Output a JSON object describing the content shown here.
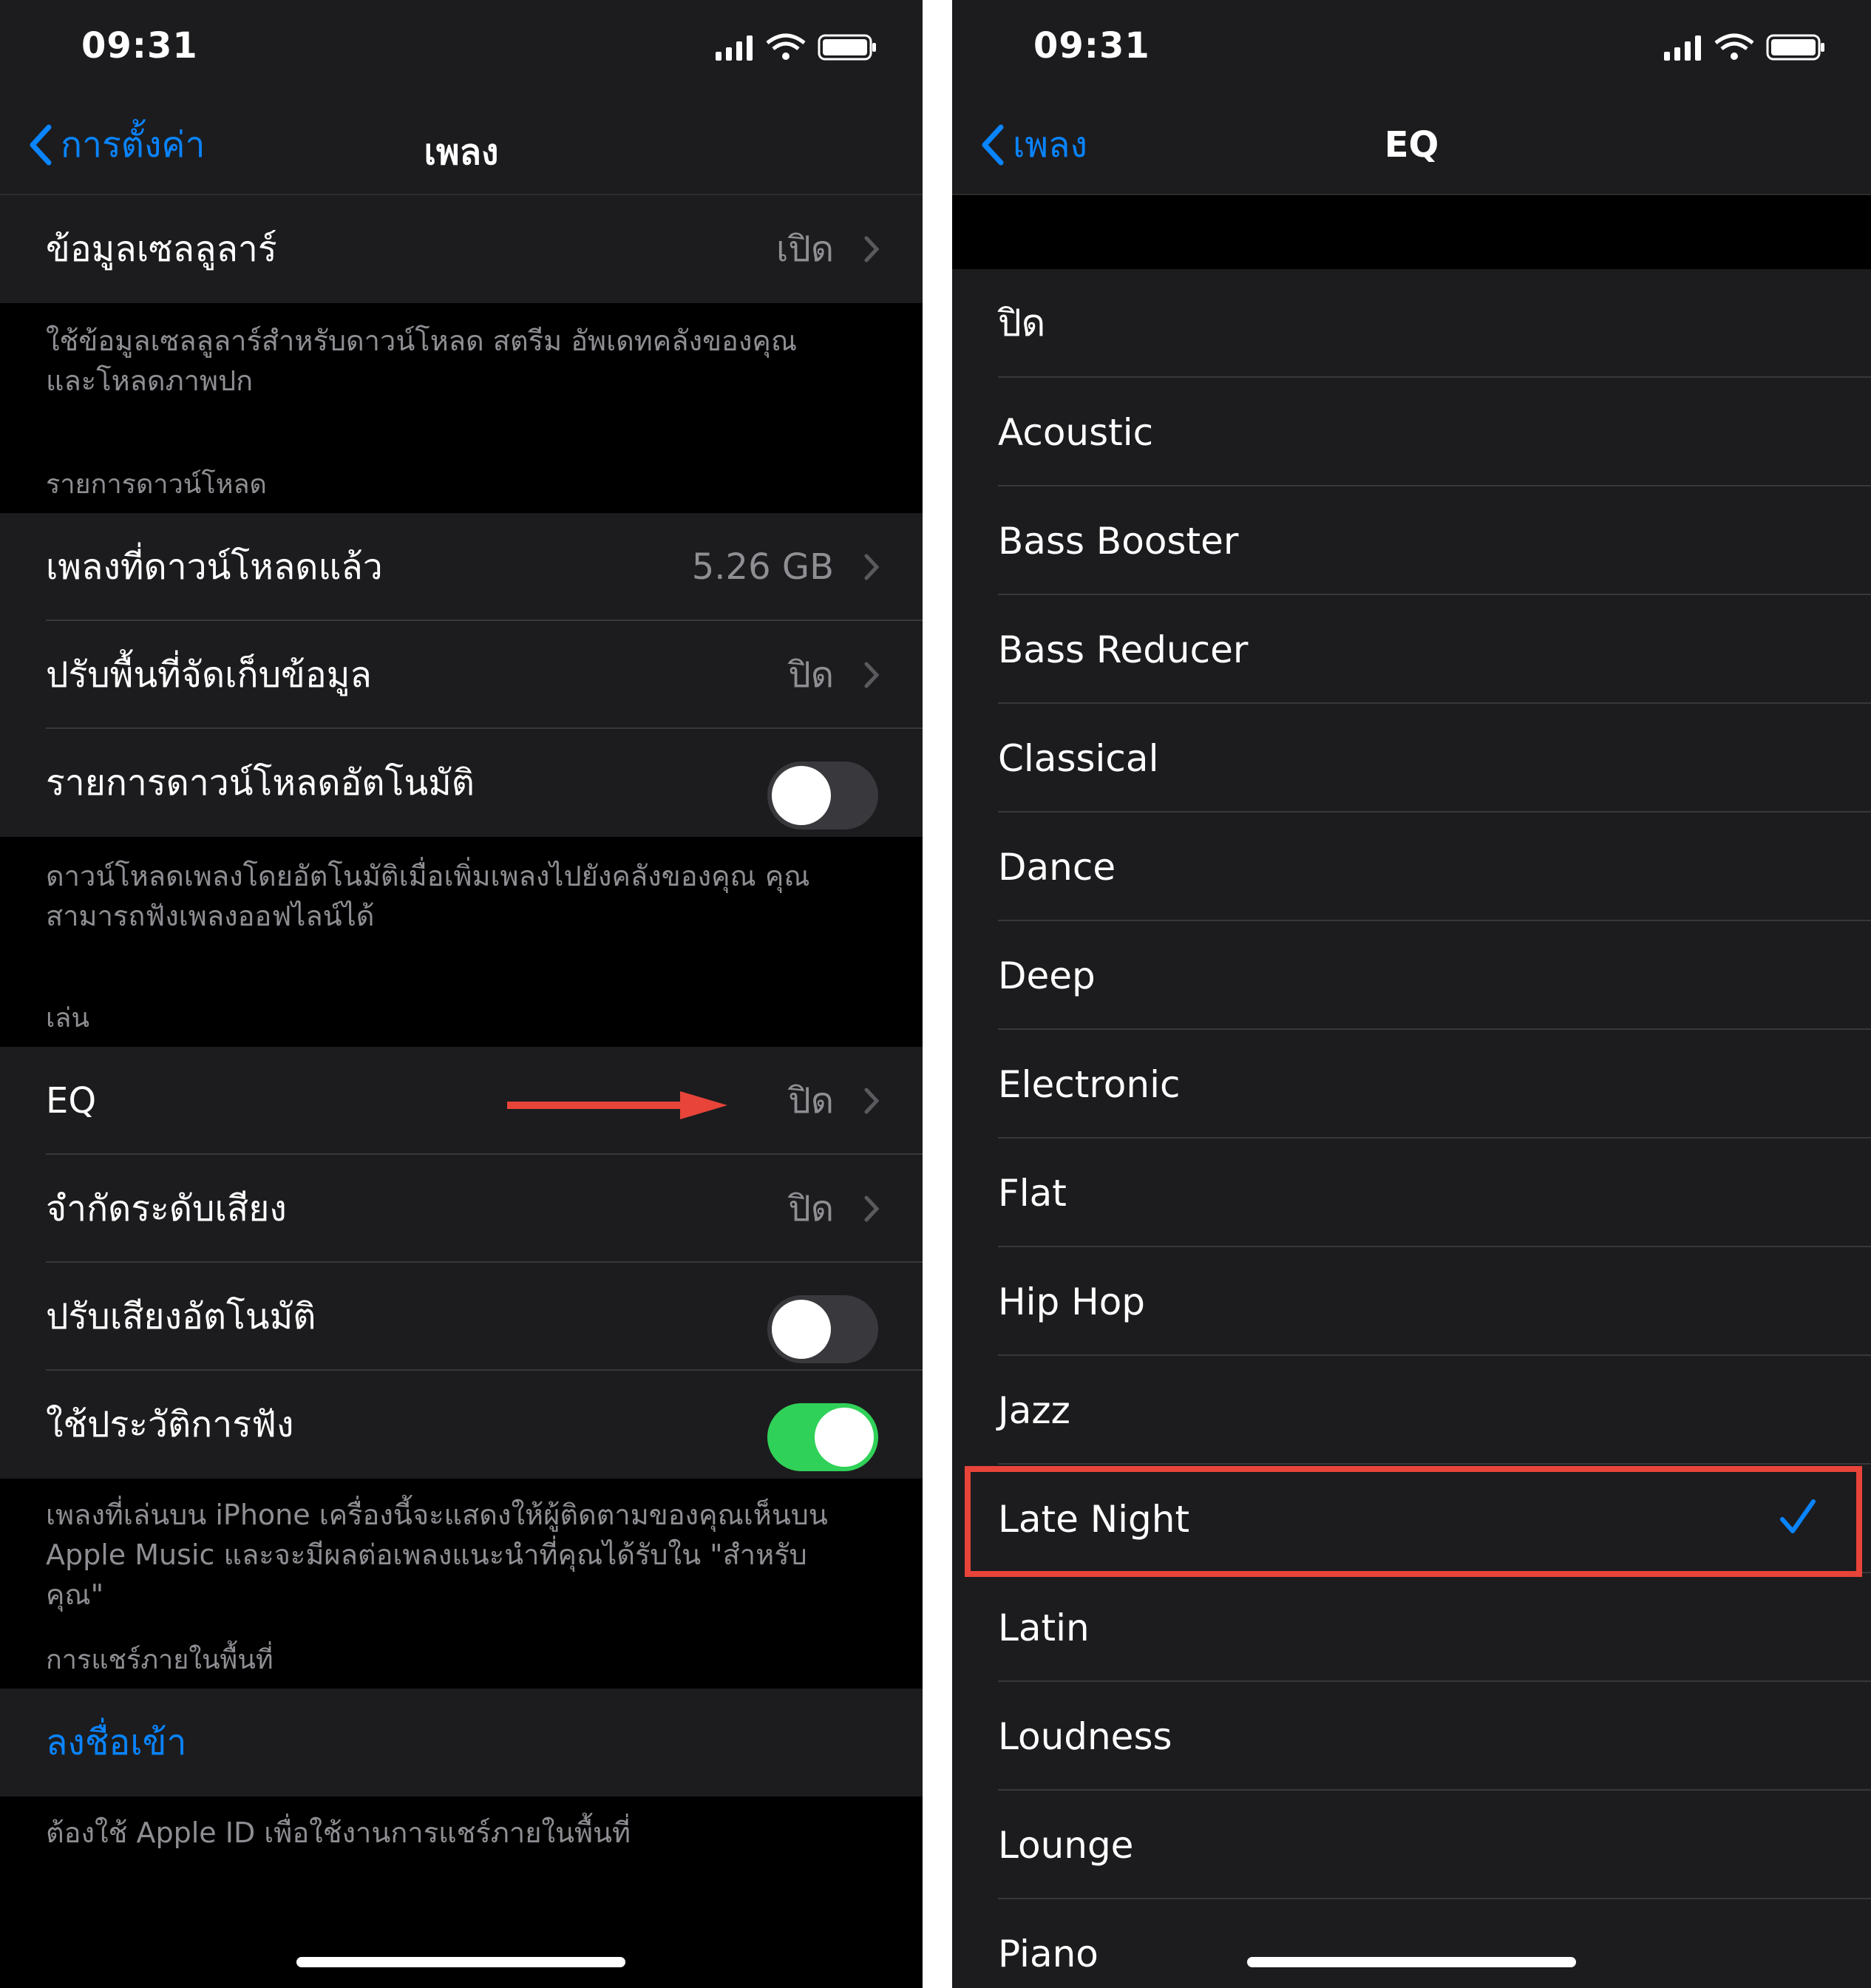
{
  "left": {
    "status": {
      "time": "09:31"
    },
    "nav": {
      "back": "การตั้งค่า",
      "title": "เพลง"
    },
    "cellular": {
      "label": "ข้อมูลเซลลูลาร์",
      "value": "เปิด"
    },
    "cellular_footer": "ใช้ข้อมูลเซลลูลาร์สำหรับดาวน์โหลด สตรีม อัพเดทคลังของคุณ และโหลดภาพปก",
    "downloads_header": "รายการดาวน์โหลด",
    "downloaded": {
      "label": "เพลงที่ดาวน์โหลดแล้ว",
      "value": "5.26 GB"
    },
    "optimize": {
      "label": "ปรับพื้นที่จัดเก็บข้อมูล",
      "value": "ปิด"
    },
    "auto_download": {
      "label": "รายการดาวน์โหลดอัตโนมัติ",
      "on": false
    },
    "auto_footer": "ดาวน์โหลดเพลงโดยอัตโนมัติเมื่อเพิ่มเพลงไปยังคลังของคุณ คุณสามารถฟังเพลงออฟไลน์ได้",
    "playback_header": "เล่น",
    "eq": {
      "label": "EQ",
      "value": "ปิด"
    },
    "volume_limit": {
      "label": "จำกัดระดับเสียง",
      "value": "ปิด"
    },
    "sound_check": {
      "label": "ปรับเสียงอัตโนมัติ",
      "on": false
    },
    "history": {
      "label": "ใช้ประวัติการฟัง",
      "on": true
    },
    "history_footer": "เพลงที่เล่นบน iPhone เครื่องนี้จะแสดงให้ผู้ติดตามของคุณเห็นบน Apple Music และจะมีผลต่อเพลงแนะนำที่คุณได้รับใน \"สำหรับคุณ\"",
    "home_sharing_header": "การแชร์ภายในพื้นที่",
    "sign_in": "ลงชื่อเข้า",
    "home_sharing_footer": "ต้องใช้ Apple ID เพื่อใช้งานการแชร์ภายในพื้นที่"
  },
  "right": {
    "status": {
      "time": "09:31"
    },
    "nav": {
      "back": "เพลง",
      "title": "EQ"
    },
    "options": [
      "ปิด",
      "Acoustic",
      "Bass Booster",
      "Bass Reducer",
      "Classical",
      "Dance",
      "Deep",
      "Electronic",
      "Flat",
      "Hip Hop",
      "Jazz",
      "Late Night",
      "Latin",
      "Loudness",
      "Lounge",
      "Piano"
    ],
    "selected": "Late Night"
  },
  "colors": {
    "accent": "#0a84ff",
    "toggle_on": "#30d158",
    "annotation": "#e8443a"
  }
}
